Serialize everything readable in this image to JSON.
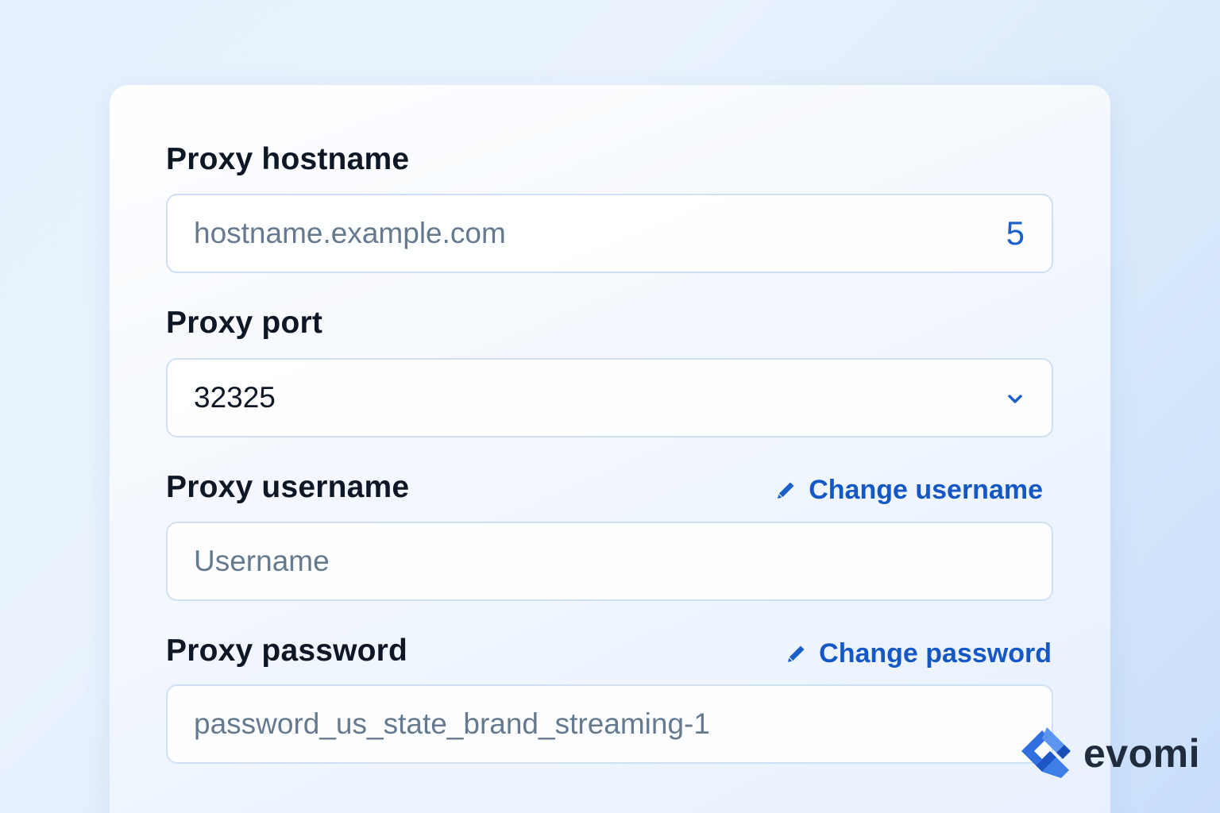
{
  "form": {
    "hostname": {
      "label": "Proxy hostname",
      "placeholder": "hostname.example.com",
      "counter": "5"
    },
    "port": {
      "label": "Proxy port",
      "value": "32325"
    },
    "username": {
      "label": "Proxy username",
      "action_label": "Change username",
      "placeholder": "Username"
    },
    "password": {
      "label": "Proxy password",
      "action_label": "Change password",
      "placeholder": "password_us_state_brand_streaming-1"
    }
  },
  "brand": {
    "name": "evomi",
    "accent_color": "#1557c5",
    "logo_color": "#2f6fe0"
  },
  "icons": {
    "edit": "pencil-icon",
    "dropdown": "chevron-down-icon"
  }
}
